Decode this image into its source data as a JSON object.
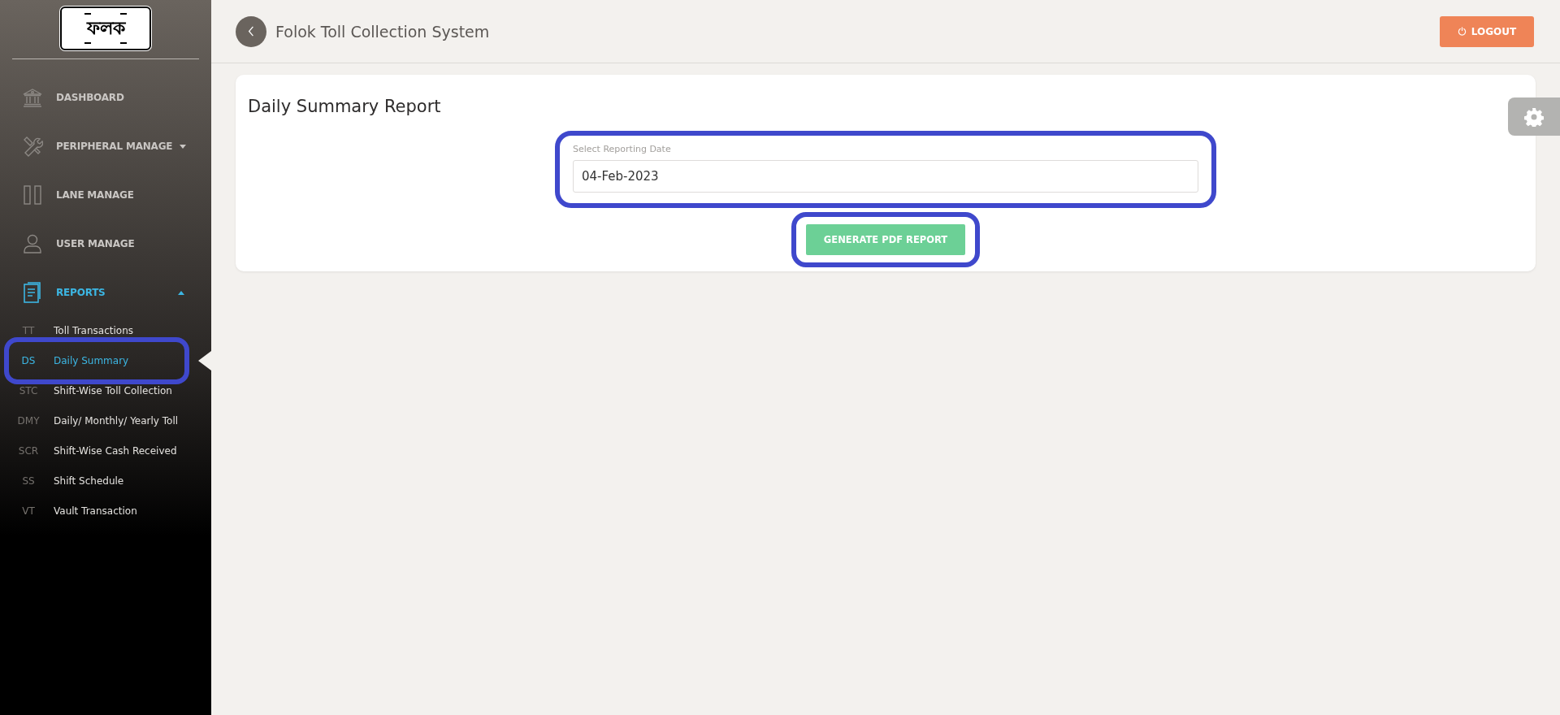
{
  "sidebar": {
    "logo_text": "ফলক",
    "menu": [
      {
        "kind": "bank",
        "label": "DASHBOARD",
        "selected": false
      },
      {
        "kind": "tools",
        "label": "PERIPHERAL MANAGE",
        "selected": false,
        "expanded": false
      },
      {
        "kind": "lanes",
        "label": "LANE MANAGE",
        "selected": false
      },
      {
        "kind": "user",
        "label": "USER MANAGE",
        "selected": false
      },
      {
        "kind": "report",
        "label": "REPORTS",
        "selected": true,
        "expanded": true,
        "children": [
          {
            "abbr": "TT",
            "label": "Toll Transactions",
            "selected": false,
            "highlighted": false
          },
          {
            "abbr": "DS",
            "label": "Daily Summary",
            "selected": true,
            "highlighted": true
          },
          {
            "abbr": "STC",
            "label": "Shift-Wise Toll Collection",
            "selected": false,
            "highlighted": false
          },
          {
            "abbr": "DMY",
            "label": "Daily/ Monthly/ Yearly Toll",
            "selected": false,
            "highlighted": false
          },
          {
            "abbr": "SCR",
            "label": "Shift-Wise Cash Received",
            "selected": false,
            "highlighted": false
          },
          {
            "abbr": "SS",
            "label": "Shift Schedule",
            "selected": false,
            "highlighted": false
          },
          {
            "abbr": "VT",
            "label": "Vault Transaction",
            "selected": false,
            "highlighted": false
          }
        ]
      }
    ]
  },
  "header": {
    "title": "Folok Toll Collection System",
    "logout": "LOGOUT"
  },
  "card": {
    "title": "Daily Summary Report",
    "date_field": {
      "label": "Select Reporting Date",
      "value": "04-Feb-2023",
      "highlighted": true
    },
    "generate_button": {
      "label": "GENERATE PDF REPORT",
      "highlighted": true
    }
  }
}
